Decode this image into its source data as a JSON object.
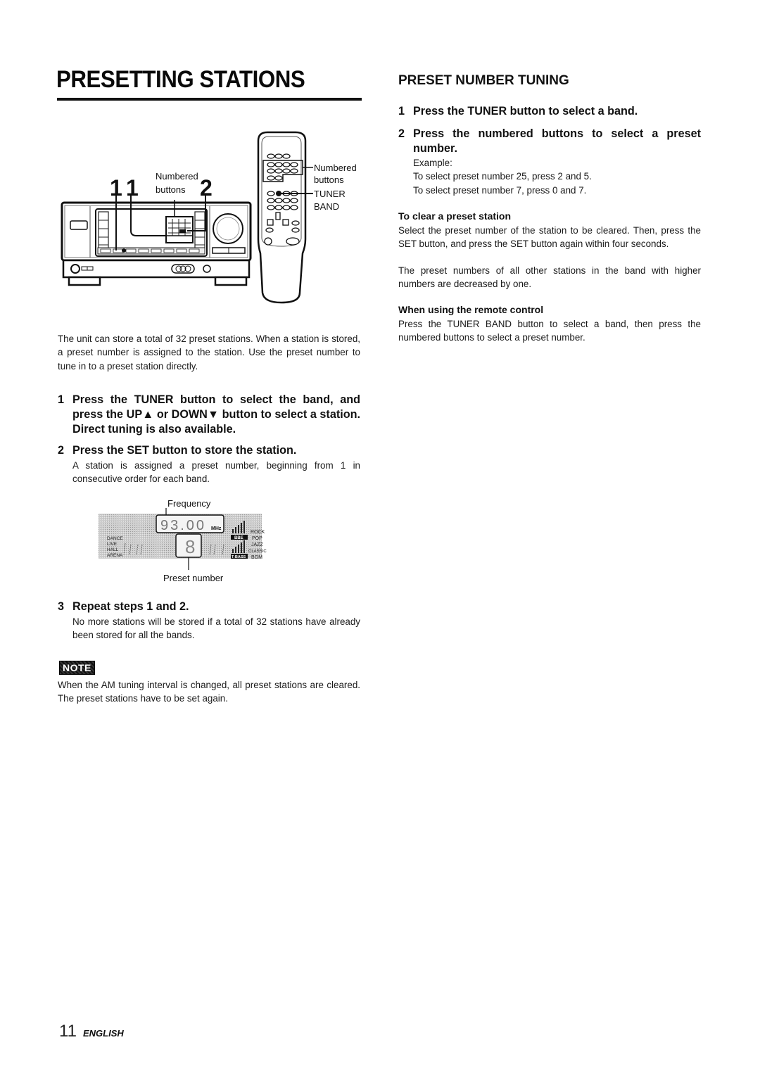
{
  "page": {
    "title": "PRESETTING STATIONS",
    "footer": {
      "page_number": "11",
      "language": "ENGLISH"
    }
  },
  "illustration": {
    "callout_step_1a": "1",
    "callout_step_1b": "1",
    "callout_step_2": "2",
    "unit_label_line1": "Numbered",
    "unit_label_line2": "buttons",
    "remote_label_numbered_line1": "Numbered",
    "remote_label_numbered_line2": "buttons",
    "remote_label_tuner_line1": "TUNER",
    "remote_label_tuner_line2": "BAND"
  },
  "left": {
    "intro": "The unit can store a total of 32 preset stations. When a station is stored, a preset number is assigned to the station. Use the preset number to tune in to a preset station directly.",
    "steps": [
      {
        "num": "1",
        "heading": "Press the TUNER button to select the band, and press the UP▲ or DOWN▼ button to select a station. Direct tuning is also available.",
        "body": ""
      },
      {
        "num": "2",
        "heading": "Press the SET button to store the station.",
        "body": "A station is assigned a preset number, beginning from 1 in consecutive order for each band."
      },
      {
        "num": "3",
        "heading": "Repeat steps 1 and 2.",
        "body": "No more stations will be stored if a total of 32 stations have already been stored for all the bands."
      }
    ],
    "display": {
      "frequency_label": "Frequency",
      "preset_label": "Preset number",
      "frequency_value": "93.00",
      "frequency_unit": "MHz",
      "preset_value": "8",
      "left_modes": [
        "DANCE",
        "LIVE",
        "HALL",
        "ARENA"
      ],
      "badges": [
        "BBE",
        "T-BASS"
      ],
      "right_modes": [
        "ROCK",
        "POP",
        "JAZZ",
        "CLASSIC",
        "BGM"
      ]
    },
    "note": {
      "badge": "NOTE",
      "text": "When the AM tuning interval is changed, all preset stations are cleared. The preset stations have to be set again."
    }
  },
  "right": {
    "heading": "PRESET NUMBER TUNING",
    "steps": [
      {
        "num": "1",
        "heading": "Press the TUNER button to select a band."
      },
      {
        "num": "2",
        "heading": "Press the numbered buttons to select a preset number."
      }
    ],
    "example_label": "Example:",
    "examples": [
      "To select preset number 25, press 2 and 5.",
      "To select preset number 7, press 0 and 7."
    ],
    "clear": {
      "heading": "To clear a preset station",
      "para1": "Select the preset number of the station to be cleared. Then, press the SET button, and press the SET button again within four seconds.",
      "para2": "The preset  numbers of all other stations in the band with higher numbers are decreased by one."
    },
    "remote": {
      "heading": "When using the remote control",
      "text": "Press the TUNER BAND button to select a band, then press the numbered buttons to select a preset number."
    }
  }
}
